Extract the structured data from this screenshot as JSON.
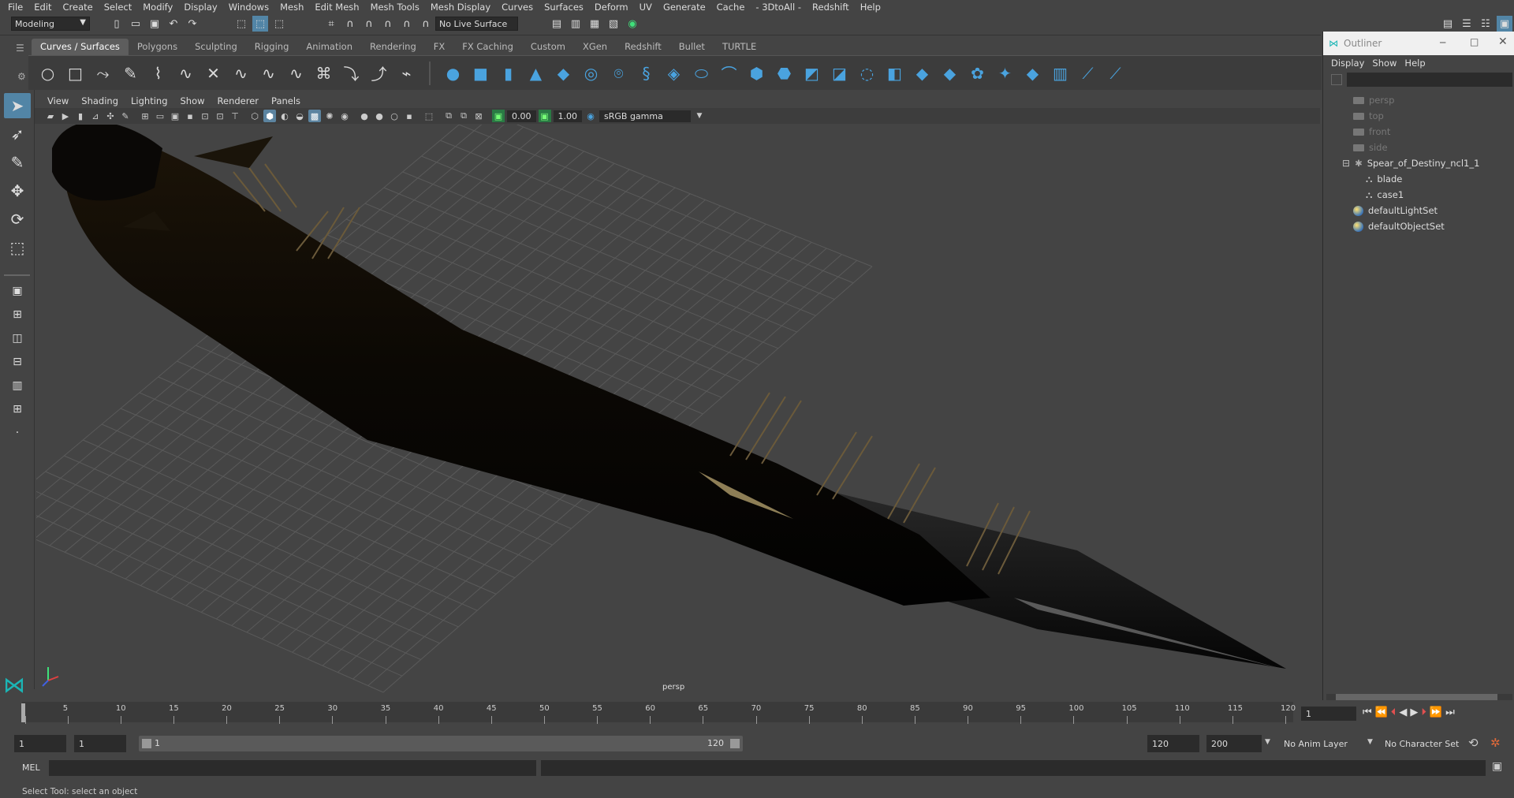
{
  "menubar": [
    "File",
    "Edit",
    "Create",
    "Select",
    "Modify",
    "Display",
    "Windows",
    "Mesh",
    "Edit Mesh",
    "Mesh Tools",
    "Mesh Display",
    "Curves",
    "Surfaces",
    "Deform",
    "UV",
    "Generate",
    "Cache",
    "- 3DtoAll -",
    "Redshift",
    "Help"
  ],
  "statusline": {
    "menu_set": "Modeling",
    "live_surface": "No Live Surface"
  },
  "shelf_tabs": [
    "Curves / Surfaces",
    "Polygons",
    "Sculpting",
    "Rigging",
    "Animation",
    "Rendering",
    "FX",
    "FX Caching",
    "Custom",
    "XGen",
    "Redshift",
    "Bullet",
    "TURTLE"
  ],
  "shelf_active": "Curves / Surfaces",
  "panel_menu": [
    "View",
    "Shading",
    "Lighting",
    "Show",
    "Renderer",
    "Panels"
  ],
  "panel_toolbar": {
    "exposure": "0.00",
    "gamma": "1.00",
    "color_space": "sRGB gamma"
  },
  "viewport": {
    "camera_label": "persp"
  },
  "outliner": {
    "title": "Outliner",
    "menu": [
      "Display",
      "Show",
      "Help"
    ],
    "items": [
      {
        "label": "persp",
        "kind": "camera"
      },
      {
        "label": "top",
        "kind": "camera"
      },
      {
        "label": "front",
        "kind": "camera"
      },
      {
        "label": "side",
        "kind": "camera"
      },
      {
        "label": "Spear_of_Destiny_ncl1_1",
        "kind": "group"
      },
      {
        "label": "blade",
        "kind": "mesh"
      },
      {
        "label": "case1",
        "kind": "mesh"
      },
      {
        "label": "defaultLightSet",
        "kind": "set"
      },
      {
        "label": "defaultObjectSet",
        "kind": "set"
      }
    ]
  },
  "timeline": {
    "ticks": [
      "1",
      "5",
      "10",
      "15",
      "20",
      "25",
      "30",
      "35",
      "40",
      "45",
      "50",
      "55",
      "60",
      "65",
      "70",
      "75",
      "80",
      "85",
      "90",
      "95",
      "100",
      "105",
      "110",
      "115",
      "120"
    ],
    "current_frame": "1"
  },
  "range": {
    "start": "1",
    "anim_start": "1",
    "range_start": "1",
    "range_end": "120",
    "anim_end": "120",
    "end": "200",
    "anim_layer": "No Anim Layer",
    "character_set": "No Character Set"
  },
  "cmdline": {
    "label": "MEL"
  },
  "helpline": "Select Tool: select an object",
  "colors": {
    "accent": "#5285a6",
    "shelf_icon_blue": "#4aa3df",
    "viewport_bg": "#444444",
    "grid": "#5a5a5a"
  }
}
